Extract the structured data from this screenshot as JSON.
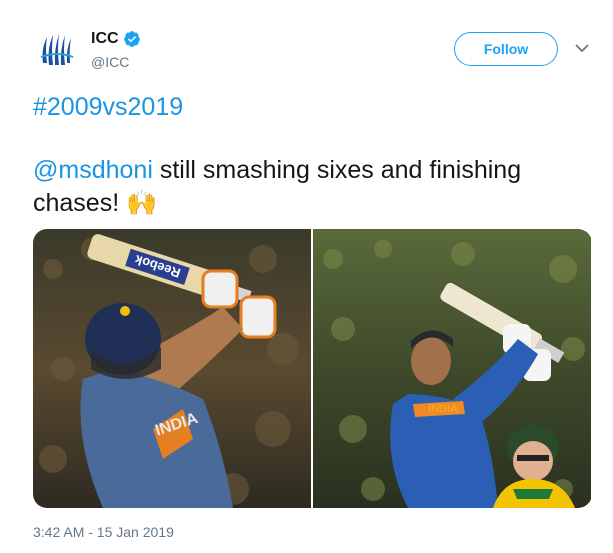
{
  "user": {
    "display_name": "ICC",
    "handle": "@ICC",
    "verified": true,
    "avatar_icon": "icc-logo-icon"
  },
  "follow_label": "Follow",
  "tweet": {
    "hashtag": "#2009vs2019",
    "mention": "@msdhoni",
    "line1_rest": " still smashing sixes and finishing",
    "line2_text": "chases! ",
    "emoji": "🙌",
    "bat_brand": "Reebok",
    "jersey_text": "INDIA",
    "timestamp": "3:42 AM - 15 Jan 2019"
  },
  "media": [
    {
      "name": "photo-2009",
      "description_icon": "cricket-batsman-2009-image"
    },
    {
      "name": "photo-2019",
      "description_icon": "cricket-batsman-2019-image"
    }
  ],
  "colors": {
    "link": "#1b95e0",
    "follow_border": "#1da1f2",
    "muted": "#657786",
    "text": "#14171a"
  }
}
